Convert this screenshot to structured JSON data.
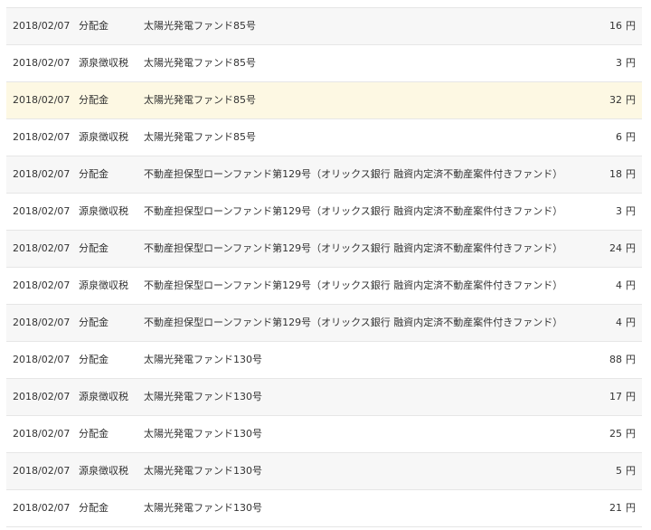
{
  "transactions": {
    "currency_unit": "円",
    "rows": [
      {
        "date": "2018/02/07",
        "type": "分配金",
        "fund": "太陽光発電ファンド85号",
        "amount": "16",
        "highlight": false
      },
      {
        "date": "2018/02/07",
        "type": "源泉徴収税",
        "fund": "太陽光発電ファンド85号",
        "amount": "3",
        "highlight": false
      },
      {
        "date": "2018/02/07",
        "type": "分配金",
        "fund": "太陽光発電ファンド85号",
        "amount": "32",
        "highlight": true
      },
      {
        "date": "2018/02/07",
        "type": "源泉徴収税",
        "fund": "太陽光発電ファンド85号",
        "amount": "6",
        "highlight": false
      },
      {
        "date": "2018/02/07",
        "type": "分配金",
        "fund": "不動産担保型ローンファンド第129号（オリックス銀行 融資内定済不動産案件付きファンド）",
        "amount": "18",
        "highlight": false
      },
      {
        "date": "2018/02/07",
        "type": "源泉徴収税",
        "fund": "不動産担保型ローンファンド第129号（オリックス銀行 融資内定済不動産案件付きファンド）",
        "amount": "3",
        "highlight": false
      },
      {
        "date": "2018/02/07",
        "type": "分配金",
        "fund": "不動産担保型ローンファンド第129号（オリックス銀行 融資内定済不動産案件付きファンド）",
        "amount": "24",
        "highlight": false
      },
      {
        "date": "2018/02/07",
        "type": "源泉徴収税",
        "fund": "不動産担保型ローンファンド第129号（オリックス銀行 融資内定済不動産案件付きファンド）",
        "amount": "4",
        "highlight": false
      },
      {
        "date": "2018/02/07",
        "type": "分配金",
        "fund": "不動産担保型ローンファンド第129号（オリックス銀行 融資内定済不動産案件付きファンド）",
        "amount": "4",
        "highlight": false
      },
      {
        "date": "2018/02/07",
        "type": "分配金",
        "fund": "太陽光発電ファンド130号",
        "amount": "88",
        "highlight": false
      },
      {
        "date": "2018/02/07",
        "type": "源泉徴収税",
        "fund": "太陽光発電ファンド130号",
        "amount": "17",
        "highlight": false
      },
      {
        "date": "2018/02/07",
        "type": "分配金",
        "fund": "太陽光発電ファンド130号",
        "amount": "25",
        "highlight": false
      },
      {
        "date": "2018/02/07",
        "type": "源泉徴収税",
        "fund": "太陽光発電ファンド130号",
        "amount": "5",
        "highlight": false
      },
      {
        "date": "2018/02/07",
        "type": "分配金",
        "fund": "太陽光発電ファンド130号",
        "amount": "21",
        "highlight": false
      }
    ]
  }
}
